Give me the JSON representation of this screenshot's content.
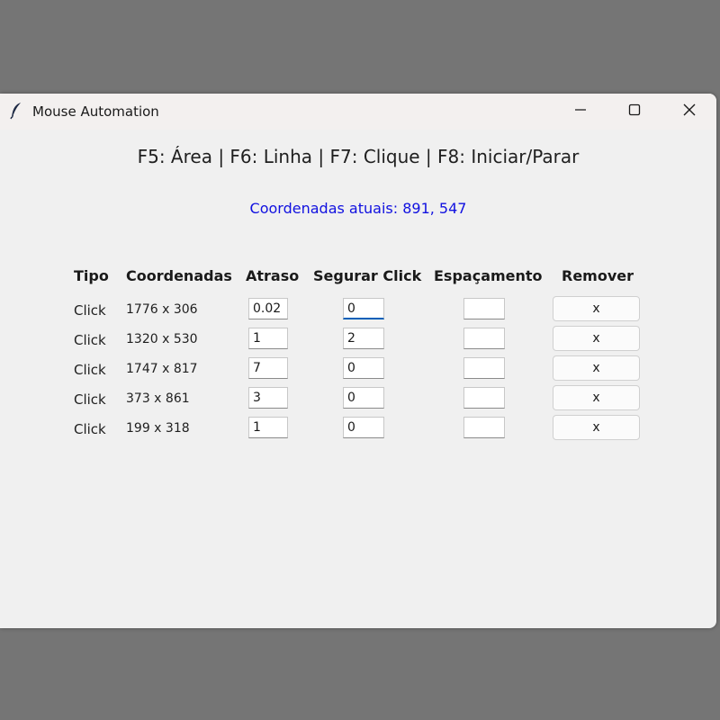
{
  "window": {
    "title": "Mouse Automation",
    "app_icon": "feather-icon",
    "controls": {
      "minimize": "minimize-icon",
      "maximize": "maximize-icon",
      "close": "close-icon"
    }
  },
  "shortcuts_label": "F5: Área | F6: Linha | F7: Clique | F8: Iniciar/Parar",
  "current_coords": "Coordenadas atuais: 891, 547",
  "colors": {
    "status_text": "#1010e0",
    "focus_accent": "#005fb8"
  },
  "table": {
    "headers": {
      "tipo": "Tipo",
      "coordenadas": "Coordenadas",
      "atraso": "Atraso",
      "segurar": "Segurar Click",
      "espacamento": "Espaçamento",
      "remover": "Remover"
    },
    "rows": [
      {
        "tipo": "Click",
        "coordenadas": "1776 x 306",
        "atraso": "0.02",
        "segurar": "0",
        "espacamento": "",
        "remover": "x"
      },
      {
        "tipo": "Click",
        "coordenadas": "1320 x 530",
        "atraso": "1",
        "segurar": "2",
        "espacamento": "",
        "remover": "x"
      },
      {
        "tipo": "Click",
        "coordenadas": "1747 x 817",
        "atraso": "7",
        "segurar": "0",
        "espacamento": "",
        "remover": "x"
      },
      {
        "tipo": "Click",
        "coordenadas": "373 x 861",
        "atraso": "3",
        "segurar": "0",
        "espacamento": "",
        "remover": "x"
      },
      {
        "tipo": "Click",
        "coordenadas": "199 x 318",
        "atraso": "1",
        "segurar": "0",
        "espacamento": "",
        "remover": "x"
      }
    ]
  }
}
